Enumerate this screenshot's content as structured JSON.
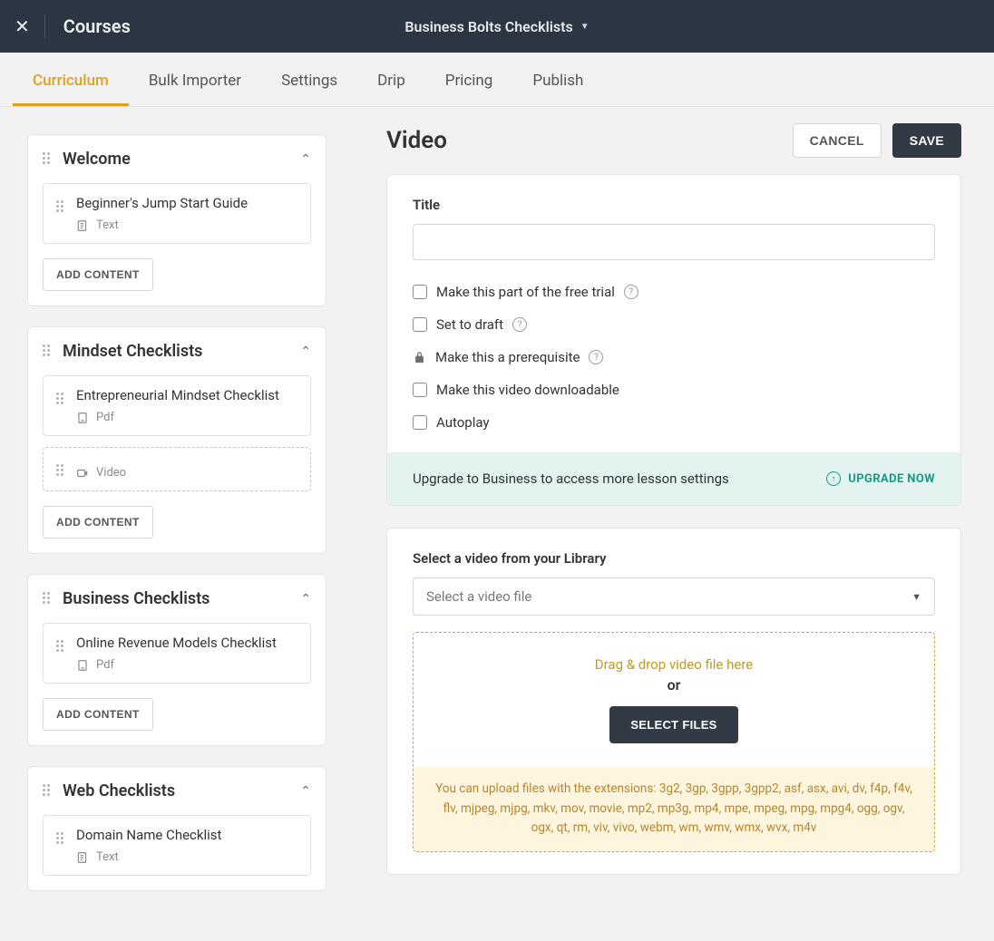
{
  "topbar": {
    "brand": "Courses",
    "course_name": "Business Bolts Checklists"
  },
  "tabs": [
    "Curriculum",
    "Bulk Importer",
    "Settings",
    "Drip",
    "Pricing",
    "Publish"
  ],
  "active_tab_index": 0,
  "chapters": [
    {
      "title": "Welcome",
      "lessons": [
        {
          "title": "Beginner's Jump Start Guide",
          "type": "Text",
          "dashed": false
        }
      ]
    },
    {
      "title": "Mindset Checklists",
      "lessons": [
        {
          "title": "Entrepreneurial Mindset Checklist",
          "type": "Pdf",
          "dashed": false
        },
        {
          "title": "",
          "type": "Video",
          "dashed": true
        }
      ]
    },
    {
      "title": "Business Checklists",
      "lessons": [
        {
          "title": "Online Revenue Models Checklist",
          "type": "Pdf",
          "dashed": false
        }
      ]
    },
    {
      "title": "Web Checklists",
      "lessons": [
        {
          "title": "Domain Name Checklist",
          "type": "Text",
          "dashed": false
        }
      ]
    }
  ],
  "add_content_label": "ADD CONTENT",
  "editor": {
    "heading": "Video",
    "cancel": "CANCEL",
    "save": "SAVE",
    "title_label": "Title",
    "title_value": "",
    "opt_free_trial": "Make this part of the free trial",
    "opt_draft": "Set to draft",
    "opt_prereq": "Make this a prerequisite",
    "opt_downloadable": "Make this video downloadable",
    "opt_autoplay": "Autoplay",
    "upgrade_msg": "Upgrade to Business to access more lesson settings",
    "upgrade_cta": "UPGRADE NOW",
    "library_label": "Select a video from your Library",
    "library_placeholder": "Select a video file",
    "drop_text": "Drag & drop video file here",
    "drop_or": "or",
    "select_files": "SELECT FILES",
    "formats_text": "You can upload files with the extensions: 3g2, 3gp, 3gpp, 3gpp2, asf, asx, avi, dv, f4p, f4v, flv, mjpeg, mjpg, mkv, mov, movie, mp2, mp3g, mp4, mpe, mpeg, mpg, mpg4, ogg, ogv, ogx, qt, rm, viv, vivo, webm, wm, wmv, wmx, wvx, m4v"
  }
}
